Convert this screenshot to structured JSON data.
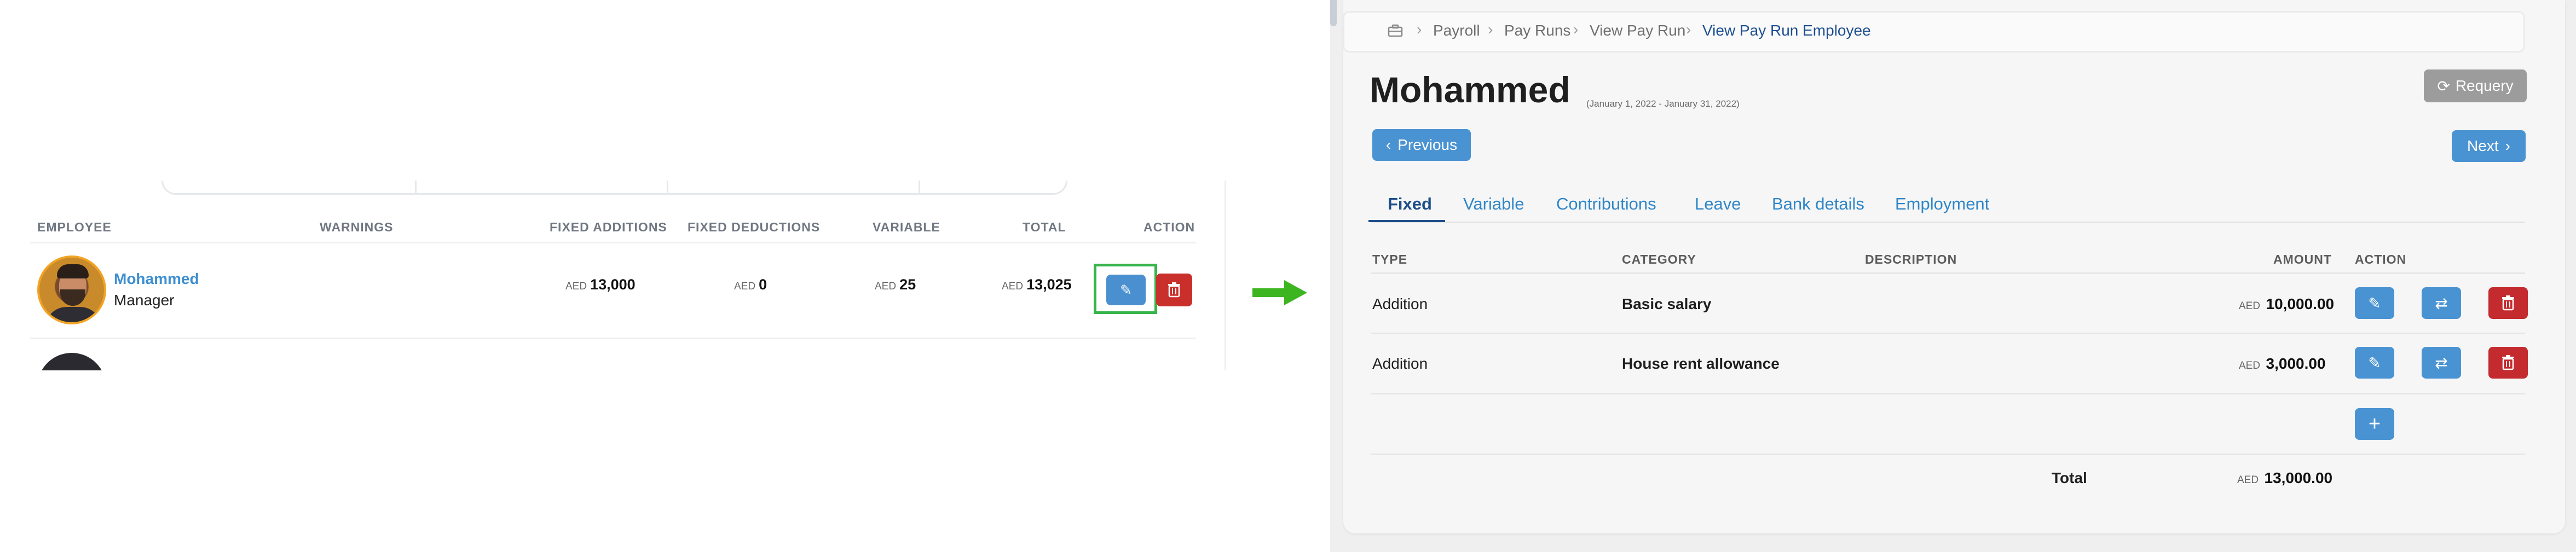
{
  "left": {
    "table_headers": [
      "EMPLOYEE",
      "WARNINGS",
      "FIXED ADDITIONS",
      "FIXED DEDUCTIONS",
      "VARIABLE",
      "TOTAL",
      "ACTION"
    ],
    "employee": {
      "name": "Mohammed",
      "role": "Manager",
      "fixed_additions_currency": "AED",
      "fixed_additions": "13,000",
      "fixed_deductions_currency": "AED",
      "fixed_deductions": "0",
      "variable_currency": "AED",
      "variable": "25",
      "total_currency": "AED",
      "total": "13,025"
    },
    "icons": {
      "edit": "pencil-icon",
      "delete": "trash-icon",
      "avatar": "person-avatar"
    }
  },
  "right": {
    "breadcrumb": [
      "Payroll",
      "Pay Runs",
      "View Pay Run",
      "View Pay Run Employee"
    ],
    "title": "Mohammed",
    "subtitle": "(January 1, 2022 - January 31, 2022)",
    "requery_label": "Requery",
    "previous_label": "Previous",
    "next_label": "Next",
    "tabs": [
      "Fixed",
      "Variable",
      "Contributions",
      "Leave",
      "Bank details",
      "Employment"
    ],
    "active_tab": "Fixed",
    "table_headers": [
      "TYPE",
      "CATEGORY",
      "DESCRIPTION",
      "AMOUNT",
      "ACTION"
    ],
    "rows": [
      {
        "type": "Addition",
        "category": "Basic salary",
        "description": "",
        "currency": "AED",
        "amount": "10,000.00"
      },
      {
        "type": "Addition",
        "category": "House rent allowance",
        "description": "",
        "currency": "AED",
        "amount": "3,000.00"
      }
    ],
    "total_label": "Total",
    "total_currency": "AED",
    "total_amount": "13,000.00"
  },
  "colors": {
    "accent_blue": "#4a93d2",
    "link_blue": "#3d8fd1",
    "active_tab": "#1d4e8a",
    "danger_red": "#c32b2f",
    "highlight_green": "#37b44a",
    "requery_gray": "#9c9c9c"
  }
}
